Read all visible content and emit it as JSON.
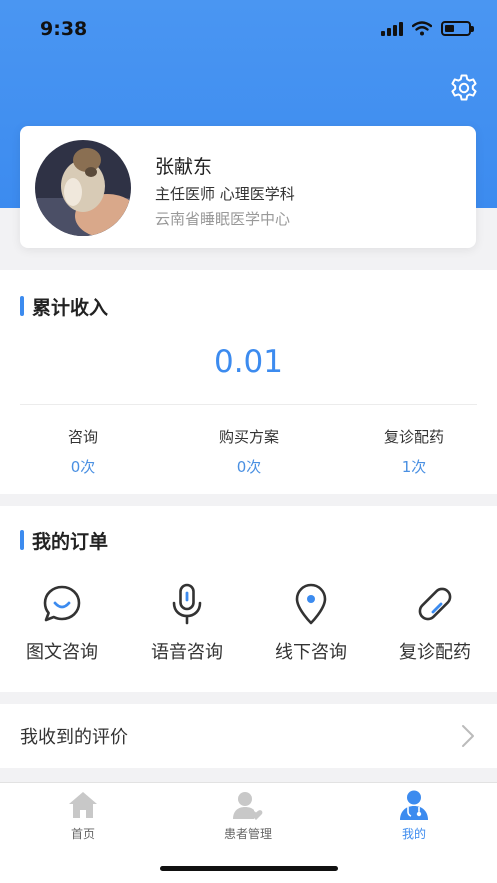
{
  "status_bar": {
    "time": "9:38"
  },
  "colors": {
    "accent": "#3c8bef",
    "header_bg": "#4a96f2"
  },
  "icons": {
    "settings": "gear-icon",
    "orders": [
      "chat-bubble-icon",
      "microphone-icon",
      "location-pin-icon",
      "pill-icon"
    ],
    "review": "chevron-right-icon",
    "tabs": [
      "home-icon",
      "patient-icon",
      "doctor-icon"
    ]
  },
  "profile": {
    "name": "张献东",
    "title": "主任医师 心理医学科",
    "hospital": "云南省睡眠医学中心"
  },
  "income": {
    "section_title": "累计收入",
    "amount": "0.01",
    "stats": [
      {
        "label": "咨询",
        "value": "0次"
      },
      {
        "label": "购买方案",
        "value": "0次"
      },
      {
        "label": "复诊配药",
        "value": "1次"
      }
    ]
  },
  "orders": {
    "section_title": "我的订单",
    "items": [
      {
        "label": "图文咨询"
      },
      {
        "label": "语音咨询"
      },
      {
        "label": "线下咨询"
      },
      {
        "label": "复诊配药"
      }
    ]
  },
  "review": {
    "label": "我收到的评价"
  },
  "tabbar": {
    "active": "我的",
    "items": [
      {
        "label": "首页"
      },
      {
        "label": "患者管理"
      },
      {
        "label": "我的"
      }
    ]
  }
}
